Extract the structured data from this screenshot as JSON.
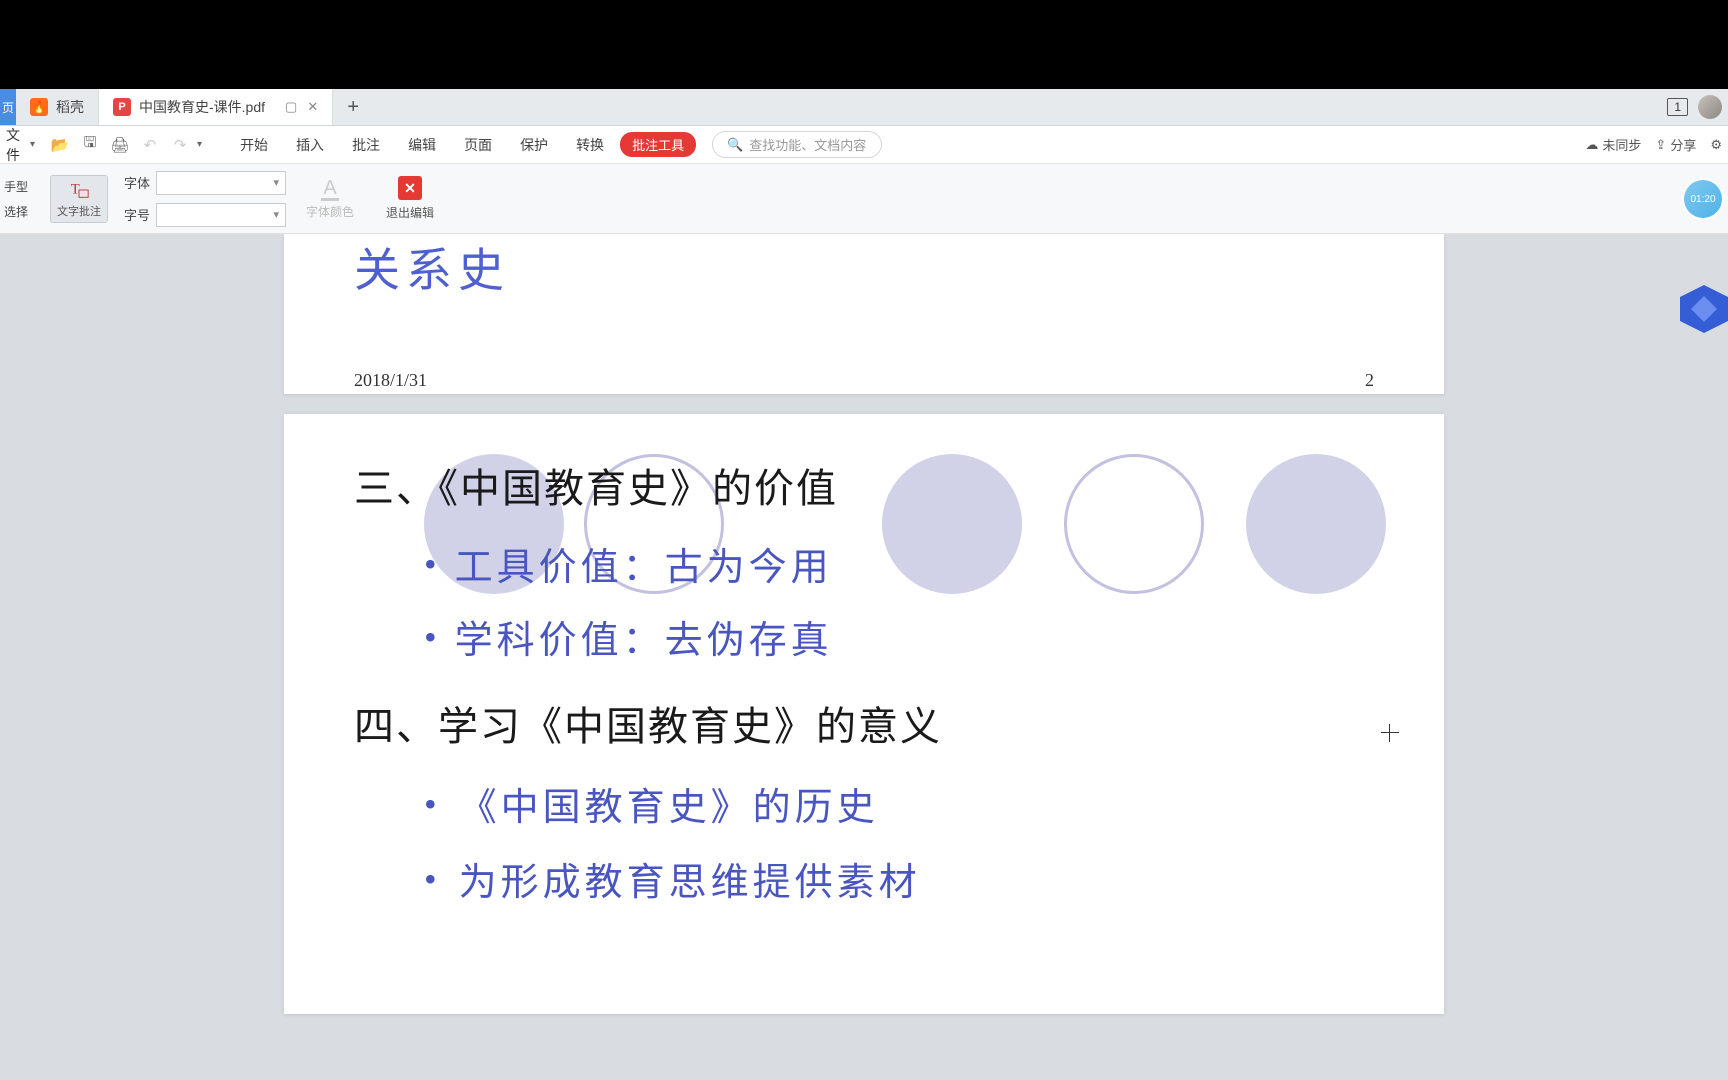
{
  "tabs": {
    "nav_partial": "页",
    "tab1_label": "稻壳",
    "tab2_label": "中国教育史-课件.pdf"
  },
  "tab_right": {
    "window_count": "1"
  },
  "menu": {
    "file_partial": "文件",
    "items": [
      "开始",
      "插入",
      "批注",
      "编辑",
      "页面",
      "保护",
      "转换"
    ],
    "badge": "批注工具",
    "search_placeholder": "查找功能、文档内容",
    "unsync": "未同步",
    "share": "分享"
  },
  "toolbar": {
    "left_hand": "手型",
    "left_select": "选择",
    "text_annot": "文字批注",
    "font_label": "字体",
    "size_label": "字号",
    "font_color": "字体颜色",
    "exit_edit": "退出编辑",
    "timer": "01:20"
  },
  "doc": {
    "page1_fragment": "关系史",
    "page1_date": "2018/1/31",
    "page1_num": "2",
    "heading3": "三、《中国教育史》的价值",
    "bullet3a": "工具价值：古为今用",
    "bullet3b": "学科价值：去伪存真",
    "heading4": "四、学习《中国教育史》的意义",
    "bullet4a": "《中国教育史》的历史",
    "bullet4b": "为形成教育思维提供素材"
  }
}
